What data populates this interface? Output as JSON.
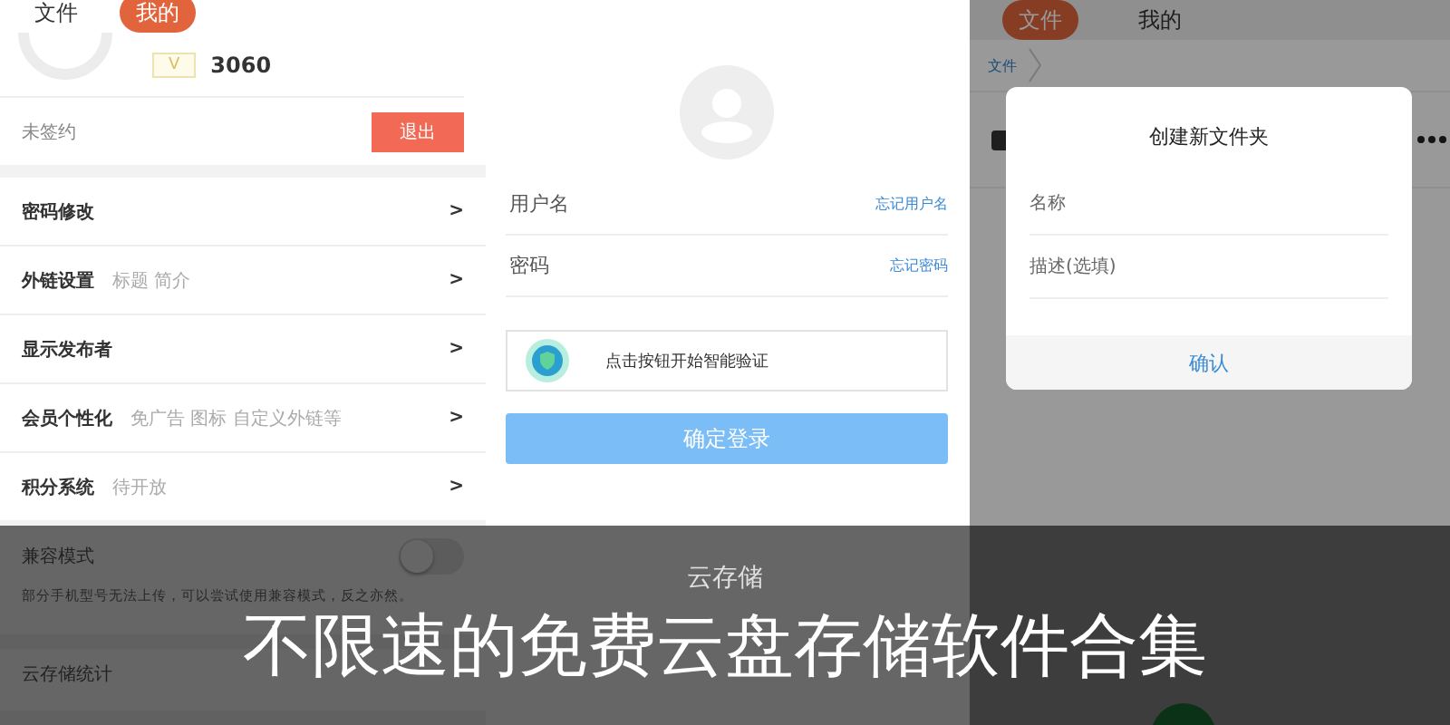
{
  "profile_screen": {
    "tabs": [
      {
        "label": "文件",
        "selected": false
      },
      {
        "label": "我的",
        "selected": true
      }
    ],
    "badge": "V",
    "points": "3060",
    "contract_status": "未签约",
    "logout_button": "退出",
    "menu": [
      {
        "label": "密码修改",
        "arrow": ">"
      },
      {
        "label": "外链设置",
        "hint": "标题 简介",
        "arrow": ">"
      },
      {
        "label": "显示发布者",
        "arrow": ">"
      },
      {
        "label": "会员个性化",
        "hint": "免广告 图标 自定义外链等",
        "arrow": ">"
      },
      {
        "label": "积分系统",
        "hint": "待开放",
        "arrow": ">"
      }
    ],
    "compat_mode": {
      "label": "兼容模式",
      "on": false,
      "note": "部分手机型号无法上传，可以尝试使用兼容模式，反之亦然。"
    },
    "section_title": "云存储统计"
  },
  "login_screen": {
    "fields": [
      {
        "placeholder": "用户名",
        "link": "忘记用户名"
      },
      {
        "placeholder": "密码",
        "link": "忘记密码"
      }
    ],
    "verify": "点击按钮开始智能验证",
    "login_button": "确定登录"
  },
  "files_screen": {
    "tabs": [
      {
        "label": "文件",
        "selected": true
      },
      {
        "label": "我的",
        "selected": false
      }
    ],
    "breadcrumb": [
      "文件"
    ],
    "dialog": {
      "title": "创建新文件夹",
      "fields": [
        {
          "placeholder": "名称"
        },
        {
          "placeholder": "描述(选填)"
        }
      ],
      "confirm": "确认"
    }
  },
  "caption": {
    "category": "云存储",
    "title": "不限速的免费云盘存储软件合集"
  }
}
